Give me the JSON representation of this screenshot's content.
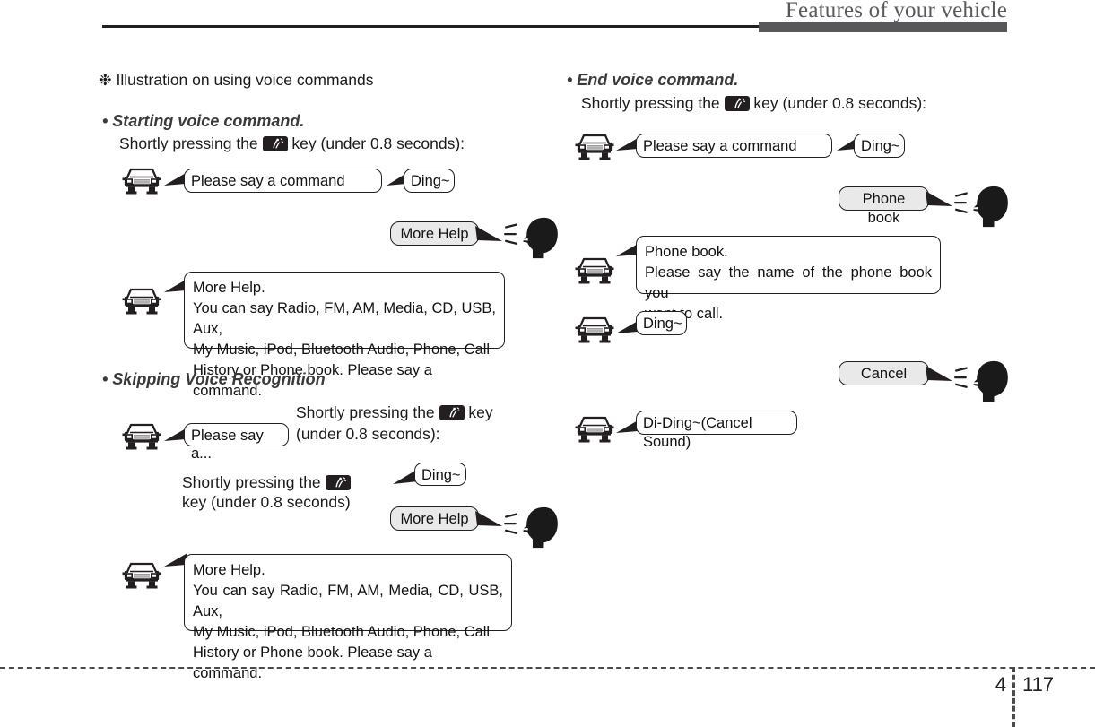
{
  "header": {
    "title": "Features of your vehicle"
  },
  "footer": {
    "chapter": "4",
    "page": "117"
  },
  "left_column": {
    "note": "❉ Illustration on using voice commands",
    "section1": {
      "heading": "• Starting voice command.",
      "line_before_key": "Shortly pressing the",
      "line_after_key": "key (under 0.8 seconds):",
      "bubbles": {
        "car_prompt": "Please say a command",
        "ding": "Ding~",
        "user_more_help": "More Help",
        "car_help_line1": "More Help.",
        "car_help_line2": "You can say Radio, FM, AM, Media, CD, USB, Aux,",
        "car_help_line3": "My Music, iPod, Bluetooth Audio, Phone, Call",
        "car_help_line4": "History or Phone book. Please say a command."
      }
    },
    "section2": {
      "heading": "• Skipping Voice Recognition",
      "instr1_before_key": "Shortly  pressing  the",
      "instr1_after_key": "key",
      "instr1_line2": "(under 0.8 seconds):",
      "instr2_before_key": "Shortly pressing the",
      "instr2_line2": "key (under 0.8 seconds)",
      "bubbles": {
        "car_prompt_partial": "Please say a...",
        "ding": "Ding~",
        "user_more_help": "More Help",
        "car_help_line1": "More Help.",
        "car_help_line2": "You can say Radio, FM, AM, Media, CD, USB, Aux,",
        "car_help_line3": "My Music, iPod, Bluetooth Audio, Phone, Call",
        "car_help_line4": "History or Phone book. Please say a command."
      }
    }
  },
  "right_column": {
    "section1": {
      "heading": "• End voice command.",
      "line_before_key": "Shortly pressing the",
      "line_after_key": "key (under 0.8 seconds):",
      "bubbles": {
        "car_prompt": "Please say a command",
        "ding1": "Ding~",
        "user_phone_book": "Phone book",
        "car_phone_line1": "Phone book.",
        "car_phone_line2": "Please say the name of the phone book you",
        "car_phone_line3": "want to call.",
        "ding2": "Ding~",
        "user_cancel": "Cancel",
        "car_cancel_sound": "Di-Ding~(Cancel Sound)"
      }
    }
  },
  "icons": {
    "car": "car-front-icon",
    "head": "speaking-head-icon",
    "voice_key": "voice-command-key-icon"
  },
  "colors": {
    "ink": "#231f20",
    "header_gray": "#5a5a5a",
    "tab_gray": "#58585a",
    "bubble_gray": "#e9e9e9"
  }
}
